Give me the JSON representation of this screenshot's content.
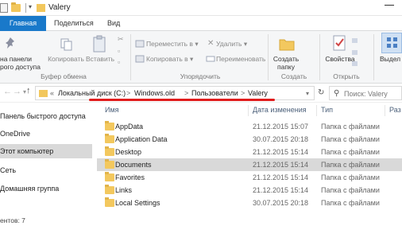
{
  "titlebar": {
    "title": "Valery",
    "qa_dropdown": "▾"
  },
  "tabs": {
    "main": "Главная",
    "share": "Поделиться",
    "view": "Вид"
  },
  "ribbon": {
    "pin_label_1": "на панели",
    "pin_label_2": "рого доступа",
    "copy_label": "Копировать",
    "paste_label": "Вставить",
    "clipboard_group": "Буфер обмена",
    "move_to": "Переместить в ▾",
    "copy_to": "Копировать в ▾",
    "delete": "Удалить ▾",
    "rename": "Переименовать",
    "organize_group": "Упорядочить",
    "new_folder_1": "Создать",
    "new_folder_2": "папку",
    "create_group": "Создать",
    "properties": "Свойства",
    "open_group": "Открыть",
    "select_label": "Выдел"
  },
  "address": {
    "prefix": "«",
    "crumbs": [
      "Локальный диск (C:)",
      "Windows.old",
      "Пользователи",
      "Valery"
    ],
    "separator": ">",
    "search_placeholder": "Поиск: Valery"
  },
  "nav": {
    "items": [
      {
        "label": "Панель быстрого доступа"
      },
      {
        "label": "OneDrive"
      },
      {
        "label": "Этот компьютер"
      },
      {
        "label": "Сеть"
      },
      {
        "label": "Домашняя группа"
      }
    ]
  },
  "columns": {
    "name": "Имя",
    "date": "Дата изменения",
    "type": "Тип",
    "size": "Раз"
  },
  "files": [
    {
      "name": "AppData",
      "date": "21.12.2015 15:07",
      "type": "Папка с файлами"
    },
    {
      "name": "Application Data",
      "date": "30.07.2015 20:18",
      "type": "Папка с файлами"
    },
    {
      "name": "Desktop",
      "date": "21.12.2015 15:14",
      "type": "Папка с файлами"
    },
    {
      "name": "Documents",
      "date": "21.12.2015 15:14",
      "type": "Папка с файлами"
    },
    {
      "name": "Favorites",
      "date": "21.12.2015 15:14",
      "type": "Папка с файлами"
    },
    {
      "name": "Links",
      "date": "21.12.2015 15:14",
      "type": "Папка с файлами"
    },
    {
      "name": "Local Settings",
      "date": "30.07.2015 20:18",
      "type": "Папка с файлами"
    }
  ],
  "status": {
    "count": "ентов: 7"
  },
  "colors": {
    "accent": "#1979ca",
    "highlight": "#e11d1d",
    "selection": "#d9d9d9",
    "folder": "#f3c85e"
  }
}
